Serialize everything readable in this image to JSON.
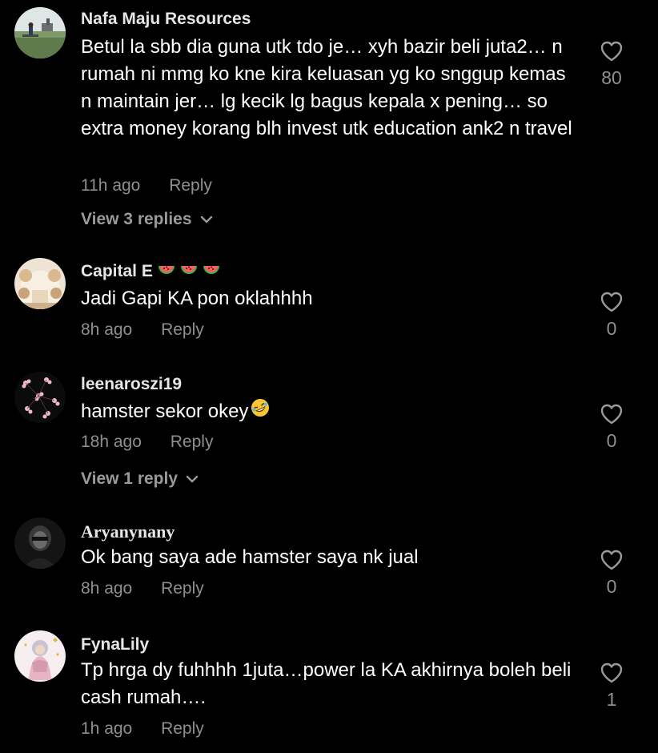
{
  "colors": {
    "background": "#000000",
    "username": "#e6e6e6",
    "text": "#ffffff",
    "meta": "#8f8f8f",
    "view_replies": "#9a9a9a",
    "watermelon_rind": "#3bb34a",
    "watermelon_flesh": "#ff5a5f"
  },
  "comments": [
    {
      "username": "Nafa Maju Resources",
      "text": "Betul la sbb dia guna utk tdo je… xyh bazir beli juta2… n rumah ni mmg ko kne kira keluasan yg ko snggup kemas n maintain jer… lg kecik lg bagus kepala x pening… so extra money korang blh invest utk education ank2 n travel",
      "time": "11h ago",
      "reply_label": "Reply",
      "likes": "80",
      "view_replies": "View 3 replies",
      "avatar_icon": "avatar-landscape-photo"
    },
    {
      "username": "Capital E",
      "username_emojis": [
        "watermelon-icon",
        "watermelon-icon",
        "watermelon-icon"
      ],
      "text": "Jadi Gapi KA pon oklahhhh",
      "time": "8h ago",
      "reply_label": "Reply",
      "likes": "0",
      "avatar_icon": "avatar-wedding-decor-photo"
    },
    {
      "username": "leenaroszi19",
      "text": "hamster sekor okey",
      "text_emoji": "rolling-laughing-emoji",
      "time": "18h ago",
      "reply_label": "Reply",
      "likes": "0",
      "view_replies": "View 1 reply",
      "avatar_icon": "avatar-pink-flowers"
    },
    {
      "username": "Aryanynany",
      "text": "Ok bang saya ade hamster saya nk jual",
      "time": "8h ago",
      "reply_label": "Reply",
      "likes": "0",
      "avatar_icon": "avatar-dark-portrait"
    },
    {
      "username": "FynaLily",
      "text": "Tp hrga dy fuhhhh 1juta…power la KA akhirnya boleh beli cash rumah….",
      "time": "1h ago",
      "reply_label": "Reply",
      "likes": "1",
      "avatar_icon": "avatar-hijab-illustration"
    }
  ]
}
